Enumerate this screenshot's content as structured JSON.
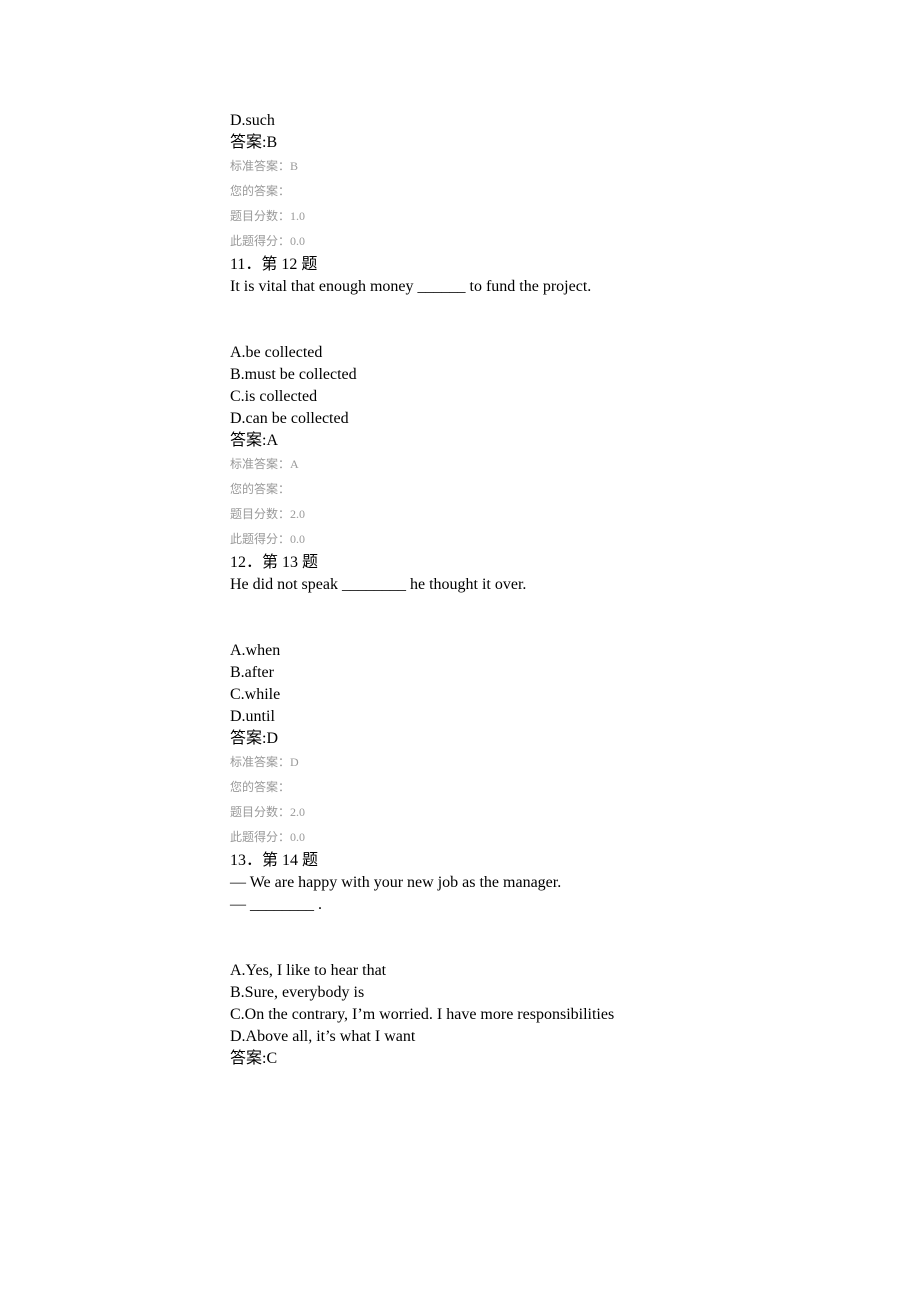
{
  "q10": {
    "optionD": "D.such",
    "answerLabel": "答案:B",
    "stdAnswer": "标准答案：B",
    "yourAnswer": "您的答案：",
    "scoreMax": "题目分数：1.0",
    "scoreGot": "此题得分：0.0"
  },
  "q11": {
    "header": "11．第 12 题",
    "body": "It is vital that enough money ______ to fund the project.",
    "optionA": "A.be collected",
    "optionB": "B.must be collected",
    "optionC": "C.is collected",
    "optionD": "D.can be collected",
    "answerLabel": "答案:A",
    "stdAnswer": "标准答案：A",
    "yourAnswer": "您的答案：",
    "scoreMax": "题目分数：2.0",
    "scoreGot": "此题得分：0.0"
  },
  "q12": {
    "header": "12．第 13 题",
    "body": "He did not speak ________ he thought it over.",
    "optionA": "A.when",
    "optionB": "B.after",
    "optionC": "C.while",
    "optionD": "D.until",
    "answerLabel": "答案:D",
    "stdAnswer": "标准答案：D",
    "yourAnswer": "您的答案：",
    "scoreMax": "题目分数：2.0",
    "scoreGot": "此题得分：0.0"
  },
  "q13": {
    "header": "13．第 14 题",
    "body1": "— We are happy with your new job as the manager.",
    "body2": "— ________ .",
    "optionA": "A.Yes, I like to hear that",
    "optionB": "B.Sure, everybody is",
    "optionC": "C.On the contrary, I’m worried. I have more responsibilities",
    "optionD": "D.Above all, it’s what I want",
    "answerLabel": "答案:C"
  }
}
